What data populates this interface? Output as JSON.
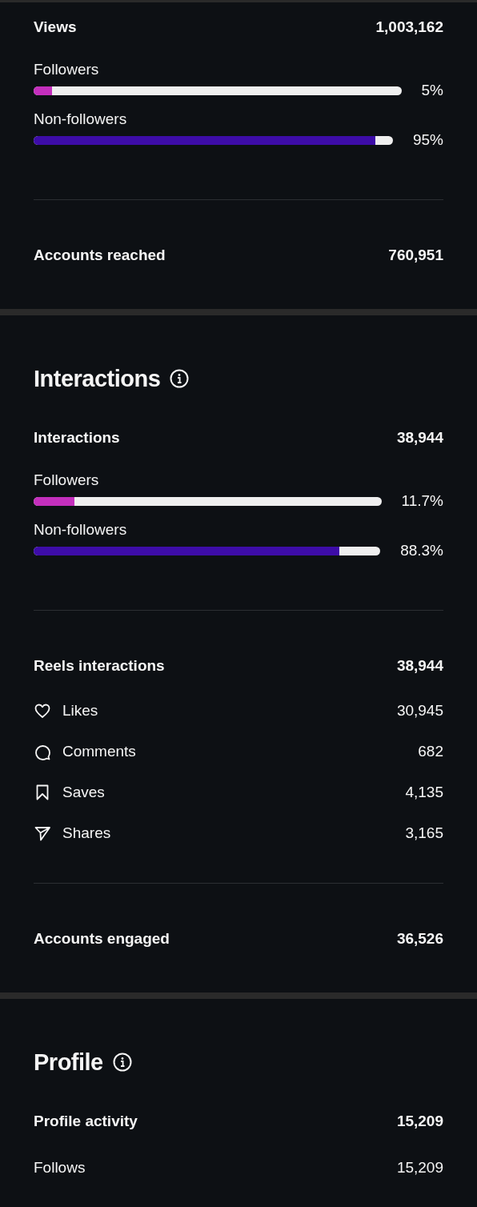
{
  "sections": [
    {
      "groups": [
        {
          "items": [
            {
              "kind": "total",
              "label": "Views",
              "value": "1,003,162"
            },
            {
              "kind": "bar",
              "label": "Followers",
              "percent": "5%",
              "level": 0.05,
              "color": "#c42fbd"
            },
            {
              "kind": "bar",
              "label": "Non-followers",
              "percent": "95%",
              "level": 0.95,
              "color": "#3d0ca8"
            }
          ]
        },
        {
          "items": [
            {
              "kind": "total",
              "label": "Accounts reached",
              "value": "760,951"
            }
          ]
        }
      ]
    },
    {
      "heading": "Interactions",
      "groups": [
        {
          "items": [
            {
              "kind": "total",
              "label": "Interactions",
              "value": "38,944"
            },
            {
              "kind": "bar",
              "label": "Followers",
              "percent": "11.7%",
              "level": 0.117,
              "color": "#c42fbd"
            },
            {
              "kind": "bar",
              "label": "Non-followers",
              "percent": "88.3%",
              "level": 0.883,
              "color": "#3d0ca8"
            }
          ]
        },
        {
          "items": [
            {
              "kind": "total",
              "label": "Reels interactions",
              "value": "38,944"
            },
            {
              "kind": "metric",
              "label": "Likes",
              "value": "30,945"
            },
            {
              "kind": "metric",
              "label": "Comments",
              "value": "682"
            },
            {
              "kind": "metric",
              "label": "Saves",
              "value": "4,135"
            },
            {
              "kind": "metric",
              "label": "Shares",
              "value": "3,165"
            }
          ]
        },
        {
          "items": [
            {
              "kind": "total",
              "label": "Accounts engaged",
              "value": "36,526"
            }
          ]
        }
      ]
    },
    {
      "heading": "Profile",
      "groups": [
        {
          "items": [
            {
              "kind": "total",
              "label": "Profile activity",
              "value": "15,209"
            },
            {
              "kind": "detail",
              "label": "Follows",
              "value": "15,209"
            }
          ]
        }
      ]
    }
  ]
}
